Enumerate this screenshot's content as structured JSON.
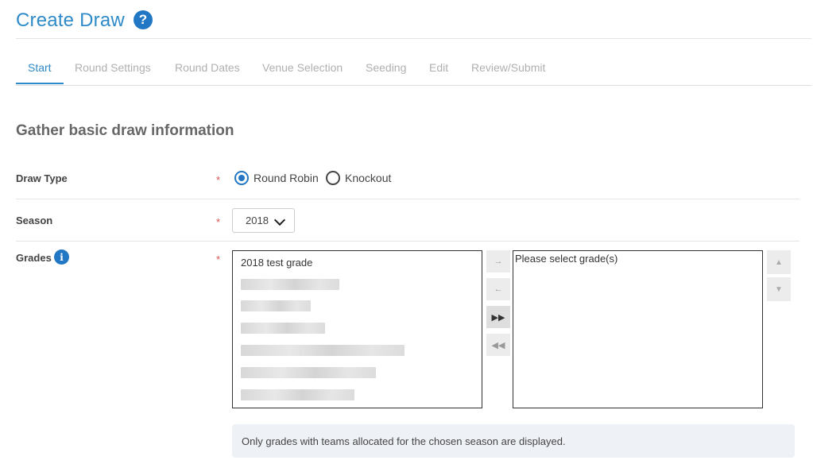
{
  "header": {
    "title": "Create Draw",
    "help_icon": "?"
  },
  "tabs": [
    {
      "label": "Start",
      "active": true
    },
    {
      "label": "Round Settings",
      "active": false
    },
    {
      "label": "Round Dates",
      "active": false
    },
    {
      "label": "Venue Selection",
      "active": false
    },
    {
      "label": "Seeding",
      "active": false
    },
    {
      "label": "Edit",
      "active": false
    },
    {
      "label": "Review/Submit",
      "active": false
    }
  ],
  "section": {
    "title": "Gather basic draw information"
  },
  "form": {
    "required_marker": "*",
    "draw_type": {
      "label": "Draw Type",
      "options": [
        "Round Robin",
        "Knockout"
      ],
      "selected": "Round Robin"
    },
    "season": {
      "label": "Season",
      "value": "2018"
    },
    "grades": {
      "label": "Grades",
      "info_icon": "i",
      "available": [
        "2018 test grade"
      ],
      "selected_placeholder": "Please select grade(s)",
      "move_buttons": [
        "→",
        "←",
        "▶▶",
        "◀◀"
      ],
      "order_buttons": [
        "▲",
        "▼"
      ],
      "notice": "Only grades with teams allocated for the chosen season are displayed."
    }
  },
  "colors": {
    "accent": "#2f8ac8",
    "icon_blue": "#2277c5",
    "required": "#d9534f"
  }
}
